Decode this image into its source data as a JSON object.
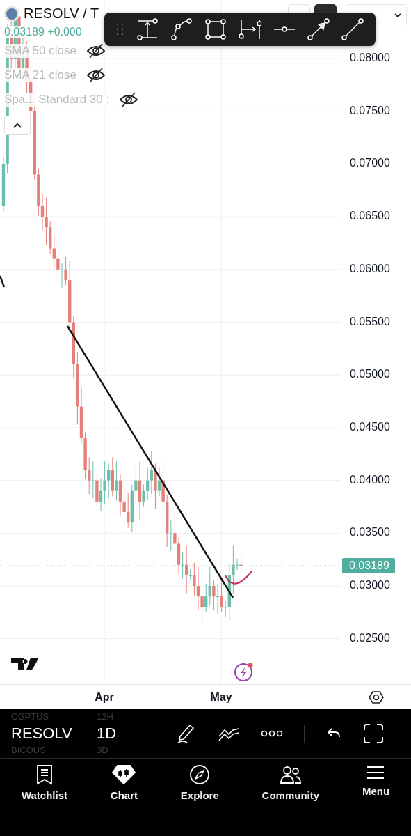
{
  "header": {
    "symbol": "RESOLV / T",
    "quote": "0.03189 +0.000"
  },
  "legend": [
    {
      "label": "SMA 50 close",
      "visible": false
    },
    {
      "label": "SMA 21 close",
      "visible": false
    },
    {
      "label": "Spa... Standard 30 :",
      "visible": false
    }
  ],
  "price_axis": [
    "0.08000",
    "0.07500",
    "0.07000",
    "0.06500",
    "0.06000",
    "0.05500",
    "0.05000",
    "0.04500",
    "0.04000",
    "0.03500",
    "0.03000",
    "0.02500"
  ],
  "last_price": "0.03189",
  "time_axis": [
    "Apr",
    "May"
  ],
  "symbol_picker": [
    {
      "label": "CGPTUS",
      "selected": false
    },
    {
      "label": "RESOLV",
      "selected": true
    },
    {
      "label": "BICOUS",
      "selected": false
    }
  ],
  "interval_picker": [
    {
      "label": "12H",
      "selected": false
    },
    {
      "label": "1D",
      "selected": true
    },
    {
      "label": "3D",
      "selected": false
    }
  ],
  "tabs": [
    {
      "label": "Watchlist",
      "kind": "watchlist",
      "selected": false
    },
    {
      "label": "Chart",
      "kind": "chart",
      "selected": true
    },
    {
      "label": "Explore",
      "kind": "explore",
      "selected": false
    },
    {
      "label": "Community",
      "kind": "community",
      "selected": false
    },
    {
      "label": "Menu",
      "kind": "menu",
      "selected": false
    }
  ]
}
